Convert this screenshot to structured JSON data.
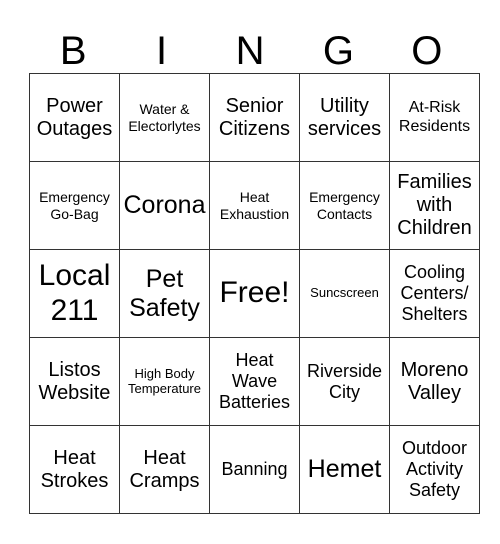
{
  "header": [
    "B",
    "I",
    "N",
    "G",
    "O"
  ],
  "rows": [
    [
      {
        "text": "Power Outages",
        "size": "s-m"
      },
      {
        "text": "Water & Electorlytes",
        "size": "s-xs"
      },
      {
        "text": "Senior Citizens",
        "size": "s-m"
      },
      {
        "text": "Utility services",
        "size": "s-m"
      },
      {
        "text": "At-Risk Residents",
        "size": "s-s"
      }
    ],
    [
      {
        "text": "Emergency Go-Bag",
        "size": "s-xs"
      },
      {
        "text": "Corona",
        "size": "s-l"
      },
      {
        "text": "Heat Exhaustion",
        "size": "s-xs"
      },
      {
        "text": "Emergency Contacts",
        "size": "s-xs"
      },
      {
        "text": "Families with Children",
        "size": "s-m"
      }
    ],
    [
      {
        "text": "Local 211",
        "size": "s-xl"
      },
      {
        "text": "Pet Safety",
        "size": "s-l"
      },
      {
        "text": "Free!",
        "size": "s-xl"
      },
      {
        "text": "Suncscreen",
        "size": "s-xxs"
      },
      {
        "text": "Cooling Centers/ Shelters",
        "size": "s-ms"
      }
    ],
    [
      {
        "text": "Listos Website",
        "size": "s-m"
      },
      {
        "text": "High Body Temperature",
        "size": "s-xxs"
      },
      {
        "text": "Heat Wave Batteries",
        "size": "s-ms"
      },
      {
        "text": "Riverside City",
        "size": "s-ms"
      },
      {
        "text": "Moreno Valley",
        "size": "s-m"
      }
    ],
    [
      {
        "text": "Heat Strokes",
        "size": "s-m"
      },
      {
        "text": "Heat Cramps",
        "size": "s-m"
      },
      {
        "text": "Banning",
        "size": "s-ms"
      },
      {
        "text": "Hemet",
        "size": "s-l"
      },
      {
        "text": "Outdoor Activity Safety",
        "size": "s-ms"
      }
    ]
  ]
}
